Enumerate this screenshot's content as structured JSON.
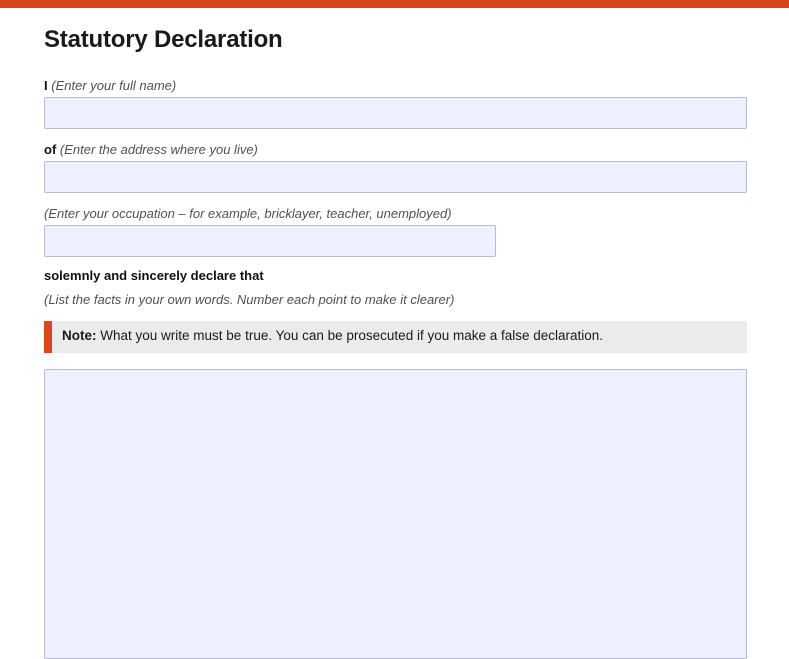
{
  "form": {
    "title": "Statutory Declaration",
    "name_field": {
      "label": "I",
      "hint": "(Enter your full name)",
      "value": ""
    },
    "address_field": {
      "label": "of",
      "hint": "(Enter the address where you live)",
      "value": ""
    },
    "occupation_field": {
      "hint": "(Enter your occupation – for example, bricklayer, teacher, unemployed)",
      "value": ""
    },
    "declaration": {
      "heading": "solemnly and sincerely declare that",
      "hint": "(List the facts in your own words. Number each point to make it clearer)",
      "value": ""
    },
    "note": {
      "label": "Note:",
      "text": "What you write must be true. You can be prosecuted if you make a false declaration."
    }
  },
  "colors": {
    "accent": "#d9451c",
    "field_background": "#eef0ff",
    "field_border": "#b9bccc",
    "note_background": "#ebebeb"
  }
}
